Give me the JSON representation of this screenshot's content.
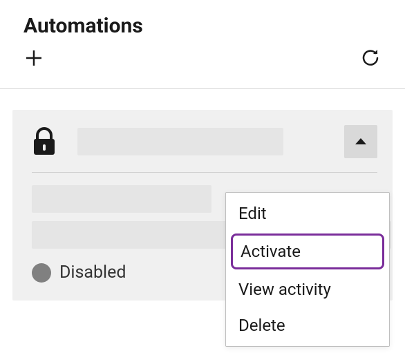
{
  "header": {
    "title": "Automations"
  },
  "toolbar": {
    "add_label": "Add",
    "refresh_label": "Refresh"
  },
  "card": {
    "status": {
      "label": "Disabled",
      "color": "#808080"
    },
    "menu": {
      "items": [
        {
          "label": "Edit",
          "highlighted": false
        },
        {
          "label": "Activate",
          "highlighted": true
        },
        {
          "label": "View activity",
          "highlighted": false
        },
        {
          "label": "Delete",
          "highlighted": false
        }
      ]
    }
  }
}
